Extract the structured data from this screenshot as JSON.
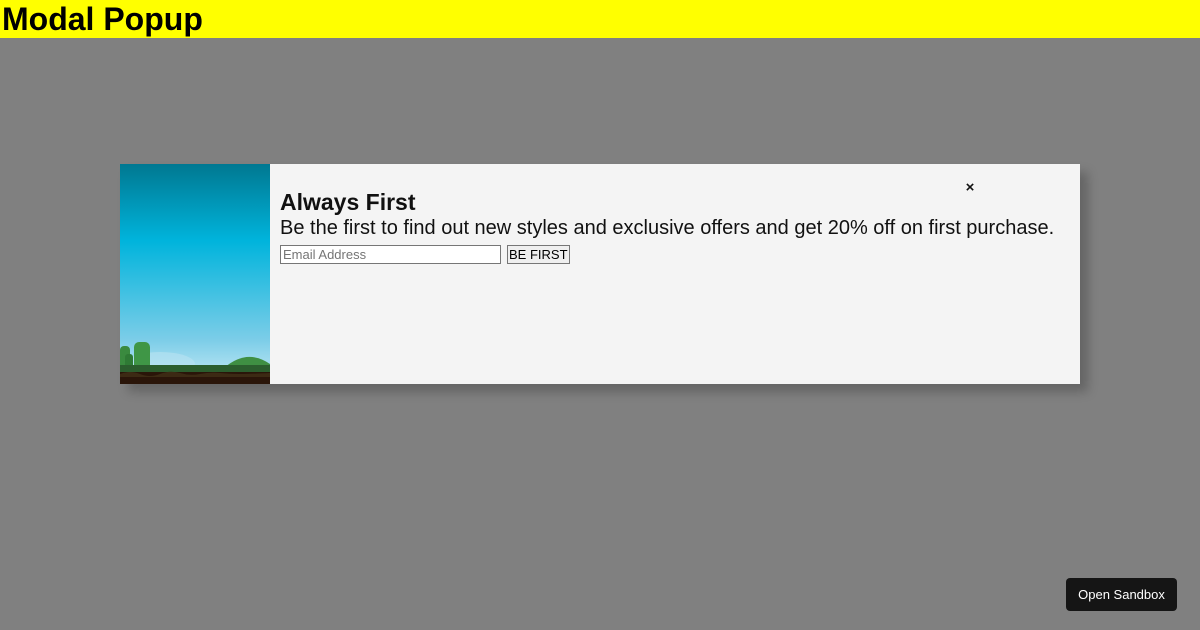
{
  "page": {
    "title": "Modal Popup"
  },
  "modal": {
    "title": "Always First",
    "text": "Be the first to find out new styles and exclusive offers and get 20% off on first purchase.",
    "email_placeholder": "Email Address",
    "submit_label": "BE FIRST",
    "close_label": "×"
  },
  "sandbox": {
    "label": "Open Sandbox"
  },
  "colors": {
    "background_overlay": "#808080",
    "header_bg": "#ffff00",
    "modal_bg": "#f4f4f4",
    "sky_top": "#007891",
    "sky_mid": "#00b4dc",
    "sky_bottom": "#aad8ea",
    "sandbox_bg": "#151515"
  }
}
